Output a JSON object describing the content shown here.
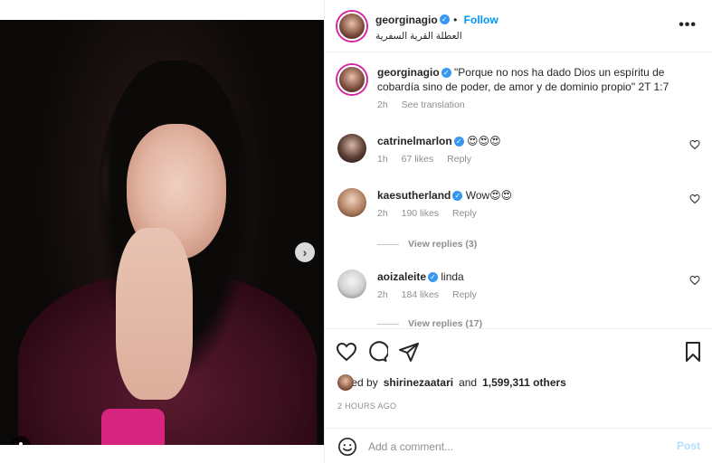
{
  "header": {
    "username": "georginagio",
    "follow_label": "Follow",
    "location": "العطلة القرية السفرية",
    "more_label": "•••"
  },
  "caption": {
    "username": "georginagio",
    "text": "\"Porque no nos ha dado Dios un espíritu de cobardía sino de poder, de amor y de dominio propio\" 2T 1:7",
    "time": "2h",
    "see_translation": "See translation"
  },
  "comments": [
    {
      "username": "catrinelmarlon",
      "verified": true,
      "text": "😍😍😍",
      "time": "1h",
      "likes": "67 likes",
      "reply": "Reply"
    },
    {
      "username": "kaesutherland",
      "verified": true,
      "text": "Wow😍😍",
      "time": "2h",
      "likes": "190 likes",
      "reply": "Reply",
      "view_replies": "View replies (3)"
    },
    {
      "username": "aoizaleite",
      "verified": true,
      "text": "linda",
      "time": "2h",
      "likes": "184 likes",
      "reply": "Reply",
      "view_replies": "View replies (17)"
    }
  ],
  "likes": {
    "prefix": "Liked by",
    "user": "shirinezaatari",
    "conjunction": "and",
    "count": "1,599,311 others"
  },
  "time_ago": "2 HOURS AGO",
  "add_comment": {
    "emoji_icon": "smiley-icon",
    "placeholder": "Add a comment...",
    "post_label": "Post"
  },
  "media": {
    "dot_count": 2,
    "active_dot": 0
  },
  "colors": {
    "accent": "#0095f6",
    "verified": "#3897f0",
    "muted": "#8e8e8e"
  }
}
